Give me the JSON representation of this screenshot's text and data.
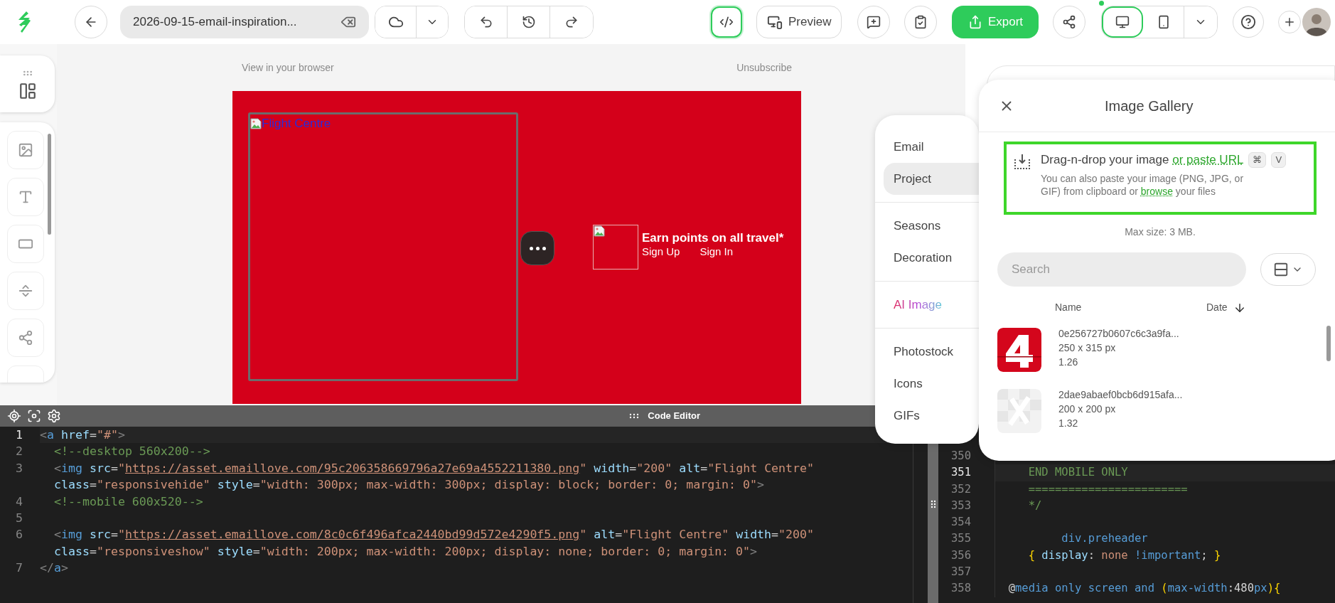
{
  "toolbar": {
    "file_name": "2026-09-15-email-inspiration...",
    "code_view": {
      "selected": true
    },
    "preview": "Preview",
    "export": "Export",
    "changes_indicator": true,
    "devices": [
      {
        "kind": "desktop",
        "selected": true
      },
      {
        "kind": "mobile",
        "selected": false
      }
    ]
  },
  "email": {
    "preheader_left": "View in your browser",
    "preheader_right": "Unsubscribe",
    "hero_alt": "Flight Centre",
    "promo_title": "Earn points on all travel*",
    "links": [
      "Sign Up",
      "Sign In"
    ]
  },
  "side_menu": {
    "groups": [
      {
        "items": [
          {
            "label": "Email",
            "kind": "plain",
            "selected": false
          },
          {
            "label": "Project",
            "kind": "plain",
            "selected": true
          }
        ]
      },
      {
        "items": [
          {
            "label": "Seasons",
            "kind": "plain",
            "selected": false
          },
          {
            "label": "Decoration",
            "kind": "plain",
            "selected": false
          }
        ]
      },
      {
        "items": [
          {
            "label": "AI Image",
            "kind": "ai",
            "selected": false
          }
        ]
      },
      {
        "items": [
          {
            "label": "Photostock",
            "kind": "plain",
            "selected": false
          },
          {
            "label": "Icons",
            "kind": "plain",
            "selected": false
          },
          {
            "label": "GIFs",
            "kind": "plain",
            "selected": false
          }
        ]
      }
    ]
  },
  "gallery": {
    "title": "Image Gallery",
    "drop_title": "Drag-n-drop your image ",
    "paste_link": "or paste URL",
    "shortcut_keys": [
      "⌘",
      "V"
    ],
    "hint_before": "You can also paste your image (PNG, JPG, or GIF) from clipboard or ",
    "hint_link": "browse",
    "hint_after": " your files",
    "max_size": "Max size: 3 MB.",
    "search": {
      "placeholder": "Search"
    },
    "columns": [
      {
        "label": "Name",
        "sorted": false
      },
      {
        "label": "Date",
        "sorted": true
      }
    ],
    "images": [
      {
        "name": "0e256727b0607c6c3a9fa...",
        "size": "250 x 315 px",
        "ratio": "1.26",
        "kind": "red"
      },
      {
        "name": "2dae9abaef0bcb6d915afa...",
        "size": "200 x 200 px",
        "ratio": "1.32",
        "kind": "light"
      }
    ]
  },
  "code_editor": {
    "title": "Code Editor",
    "lines": [
      {
        "number": "1",
        "current": true,
        "tokens": [
          {
            "kind": "punct",
            "text": "<"
          },
          {
            "kind": "tag",
            "text": "a"
          },
          {
            "kind": "attr",
            "text": " href"
          },
          {
            "kind": "plain",
            "text": "="
          },
          {
            "kind": "string",
            "text": "\"#\""
          },
          {
            "kind": "punct",
            "text": ">"
          }
        ]
      },
      {
        "number": "2",
        "current": false,
        "tokens": [
          {
            "kind": "comment",
            "text": "  <!--desktop 560x200-->"
          }
        ]
      },
      {
        "number": "3",
        "current": false,
        "tokens": [
          {
            "kind": "punct",
            "text": "  <"
          },
          {
            "kind": "tag",
            "text": "img"
          },
          {
            "kind": "attr",
            "text": " src"
          },
          {
            "kind": "plain",
            "text": "="
          },
          {
            "kind": "string",
            "text": "\""
          },
          {
            "kind": "link",
            "text": "https://asset.emaillove.com/95c206358669796a27e69a4552211380.png"
          },
          {
            "kind": "string",
            "text": "\""
          },
          {
            "kind": "attr",
            "text": " width"
          },
          {
            "kind": "plain",
            "text": "="
          },
          {
            "kind": "string",
            "text": "\"200\""
          },
          {
            "kind": "attr",
            "text": " alt"
          },
          {
            "kind": "plain",
            "text": "="
          },
          {
            "kind": "string",
            "text": "\"Flight Centre\""
          }
        ]
      },
      {
        "tokens": [
          {
            "kind": "attr",
            "text": "  class"
          },
          {
            "kind": "plain",
            "text": "="
          },
          {
            "kind": "string",
            "text": "\"responsivehide\""
          },
          {
            "kind": "attr",
            "text": " style"
          },
          {
            "kind": "plain",
            "text": "="
          },
          {
            "kind": "string",
            "text": "\"width: 300px; max-width: 300px; display: block; border: 0; margin: 0\""
          },
          {
            "kind": "punct",
            "text": ">"
          }
        ]
      },
      {
        "number": "4",
        "current": false,
        "tokens": [
          {
            "kind": "comment",
            "text": "  <!--mobile 600x520-->"
          }
        ]
      },
      {
        "number": "5",
        "current": false
      },
      {
        "number": "6",
        "current": false,
        "tokens": [
          {
            "kind": "punct",
            "text": "  <"
          },
          {
            "kind": "tag",
            "text": "img"
          },
          {
            "kind": "attr",
            "text": " src"
          },
          {
            "kind": "plain",
            "text": "="
          },
          {
            "kind": "string",
            "text": "\""
          },
          {
            "kind": "link",
            "text": "https://asset.emaillove.com/8c0c6f496afca2440bd99d572e4290f5.png"
          },
          {
            "kind": "string",
            "text": "\""
          },
          {
            "kind": "attr",
            "text": " alt"
          },
          {
            "kind": "plain",
            "text": "="
          },
          {
            "kind": "string",
            "text": "\"Flight Centre\""
          },
          {
            "kind": "attr",
            "text": " width"
          },
          {
            "kind": "plain",
            "text": "="
          },
          {
            "kind": "string",
            "text": "\"200\""
          }
        ]
      },
      {
        "tokens": [
          {
            "kind": "attr",
            "text": "  class"
          },
          {
            "kind": "plain",
            "text": "="
          },
          {
            "kind": "string",
            "text": "\"responsiveshow\""
          },
          {
            "kind": "attr",
            "text": " style"
          },
          {
            "kind": "plain",
            "text": "="
          },
          {
            "kind": "string",
            "text": "\"width: 200px; max-width: 200px; display: none; border: 0; margin: 0\""
          },
          {
            "kind": "punct",
            "text": ">"
          }
        ]
      },
      {
        "number": "7",
        "current": false,
        "tokens": [
          {
            "kind": "punct",
            "text": "</"
          },
          {
            "kind": "tag",
            "text": "a"
          },
          {
            "kind": "punct",
            "text": ">"
          }
        ]
      }
    ]
  },
  "css_editor": {
    "lines": [
      {
        "number": "350",
        "current": false
      },
      {
        "number": "351",
        "current": true,
        "tokens": [
          {
            "kind": "comment",
            "text": "     END MOBILE ONLY"
          }
        ]
      },
      {
        "number": "352",
        "current": false,
        "tokens": [
          {
            "kind": "comment",
            "text": "     ========================"
          }
        ]
      },
      {
        "number": "353",
        "current": false,
        "tokens": [
          {
            "kind": "comment",
            "text": "     */"
          }
        ]
      },
      {
        "number": "354",
        "current": false
      },
      {
        "number": "355",
        "current": false,
        "tokens": [
          {
            "kind": "tag",
            "text": "          div.preheader"
          }
        ]
      },
      {
        "number": "356",
        "current": false,
        "tokens": [
          {
            "kind": "brace",
            "text": "     {"
          },
          {
            "kind": "attr",
            "text": " display"
          },
          {
            "kind": "plain",
            "text": ":"
          },
          {
            "kind": "string",
            "text": " none"
          },
          {
            "kind": "tag",
            "text": " !important"
          },
          {
            "kind": "plain",
            "text": ";"
          },
          {
            "kind": "brace",
            "text": " }"
          }
        ]
      },
      {
        "number": "357",
        "current": false
      },
      {
        "number": "358",
        "current": false,
        "tokens": [
          {
            "kind": "plain",
            "text": "  @"
          },
          {
            "kind": "tag",
            "text": "media only screen and "
          },
          {
            "kind": "brace",
            "text": "("
          },
          {
            "kind": "tag",
            "text": "max-width"
          },
          {
            "kind": "plain",
            "text": ":480"
          },
          {
            "kind": "tag",
            "text": "px"
          },
          {
            "kind": "brace",
            "text": ")"
          },
          {
            "kind": "brace",
            "text": "{"
          }
        ]
      }
    ]
  }
}
